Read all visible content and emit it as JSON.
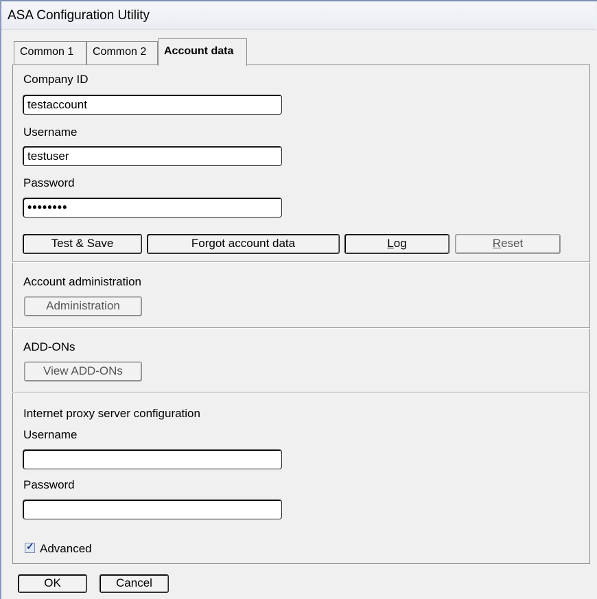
{
  "window": {
    "title": "ASA Configuration Utility"
  },
  "tabs": [
    {
      "label": "Common 1",
      "active": false
    },
    {
      "label": "Common 2",
      "active": false
    },
    {
      "label": "Account data",
      "active": true
    }
  ],
  "account": {
    "company_id_label": "Company ID",
    "company_id_value": "testaccount",
    "username_label": "Username",
    "username_value": "testuser",
    "password_label": "Password",
    "password_value": "••••••••",
    "buttons": {
      "test_save": "Test & Save",
      "forgot": "Forgot account data",
      "log": "Log",
      "reset": "Reset"
    }
  },
  "administration": {
    "heading": "Account administration",
    "button": "Administration"
  },
  "addons": {
    "heading": "ADD-ONs",
    "button": "View ADD-ONs"
  },
  "proxy": {
    "heading": "Internet proxy server configuration",
    "username_label": "Username",
    "username_value": "",
    "password_label": "Password",
    "password_value": ""
  },
  "advanced": {
    "label": "Advanced",
    "checked": true
  },
  "footer": {
    "ok": "OK",
    "cancel": "Cancel"
  }
}
